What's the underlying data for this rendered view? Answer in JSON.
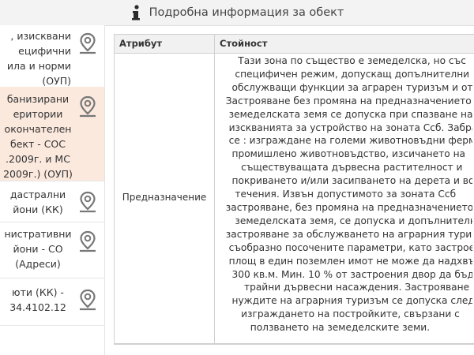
{
  "header": {
    "title": "Подробна информация за обект",
    "icon": "info-icon"
  },
  "layers": [
    {
      "lines": ", изисквани\nецифични\nила и норми\n(ОУП)",
      "icon": "map-pin-icon"
    },
    {
      "lines": "банизирани\nеритории\nокончателен\nбект - СОС\n.2009г. и МС\n2009г.) (ОУП)",
      "icon": "map-pin-icon",
      "active": true
    },
    {
      "lines": "дастрални\nйони (КК)",
      "icon": "map-pin-icon"
    },
    {
      "lines": "нистративни\nйони - СО\n(Адреси)",
      "icon": "map-pin-icon"
    },
    {
      "lines": "юти (КК) -\n34.4102.12",
      "icon": "map-pin-icon"
    }
  ],
  "table": {
    "headers": [
      "Атрибут",
      "Стойност"
    ],
    "rows": [
      {
        "attribute": "Предназначение",
        "value_lines": "      Тази зона по същество е земеделска, но със\n     специфичен режим, допускащ допълнителни\n    обслужващи функции за аграрен туризъм и отдих.\n  Застрояване без промяна на предназначението на\n   земеделската земя се допуска при спазване на\n   изскванията за устройство на зоната Ссб. Забранява\n   се : изграждане на големи животновъдни ферми за\n    промишлено животновъдство, изсичането на\n       съществуващата дървесна растителност и\n    покриването и/или засипването на дерета и водни\n     течения. Извън допустимото за зоната Ссб\n  застрояване, без промяна на предназначението на\n     земеделската земя, се допуска и допълнително\n  застрояване за обслужването на аграрния туризъм\n   съобразно посочените параметри, като застроената\n   площ в един поземлен имот не може да надхвърля\n    300 кв.м. Мин. 10 % от застроения двор да бъде с\n        трайни дървесни насаждения. Застрояване за\n    нуждите на аграрния туризъм се допуска след\n       изграждането на постройките, свързани с\n          ползването на земеделските земи."
      }
    ]
  }
}
